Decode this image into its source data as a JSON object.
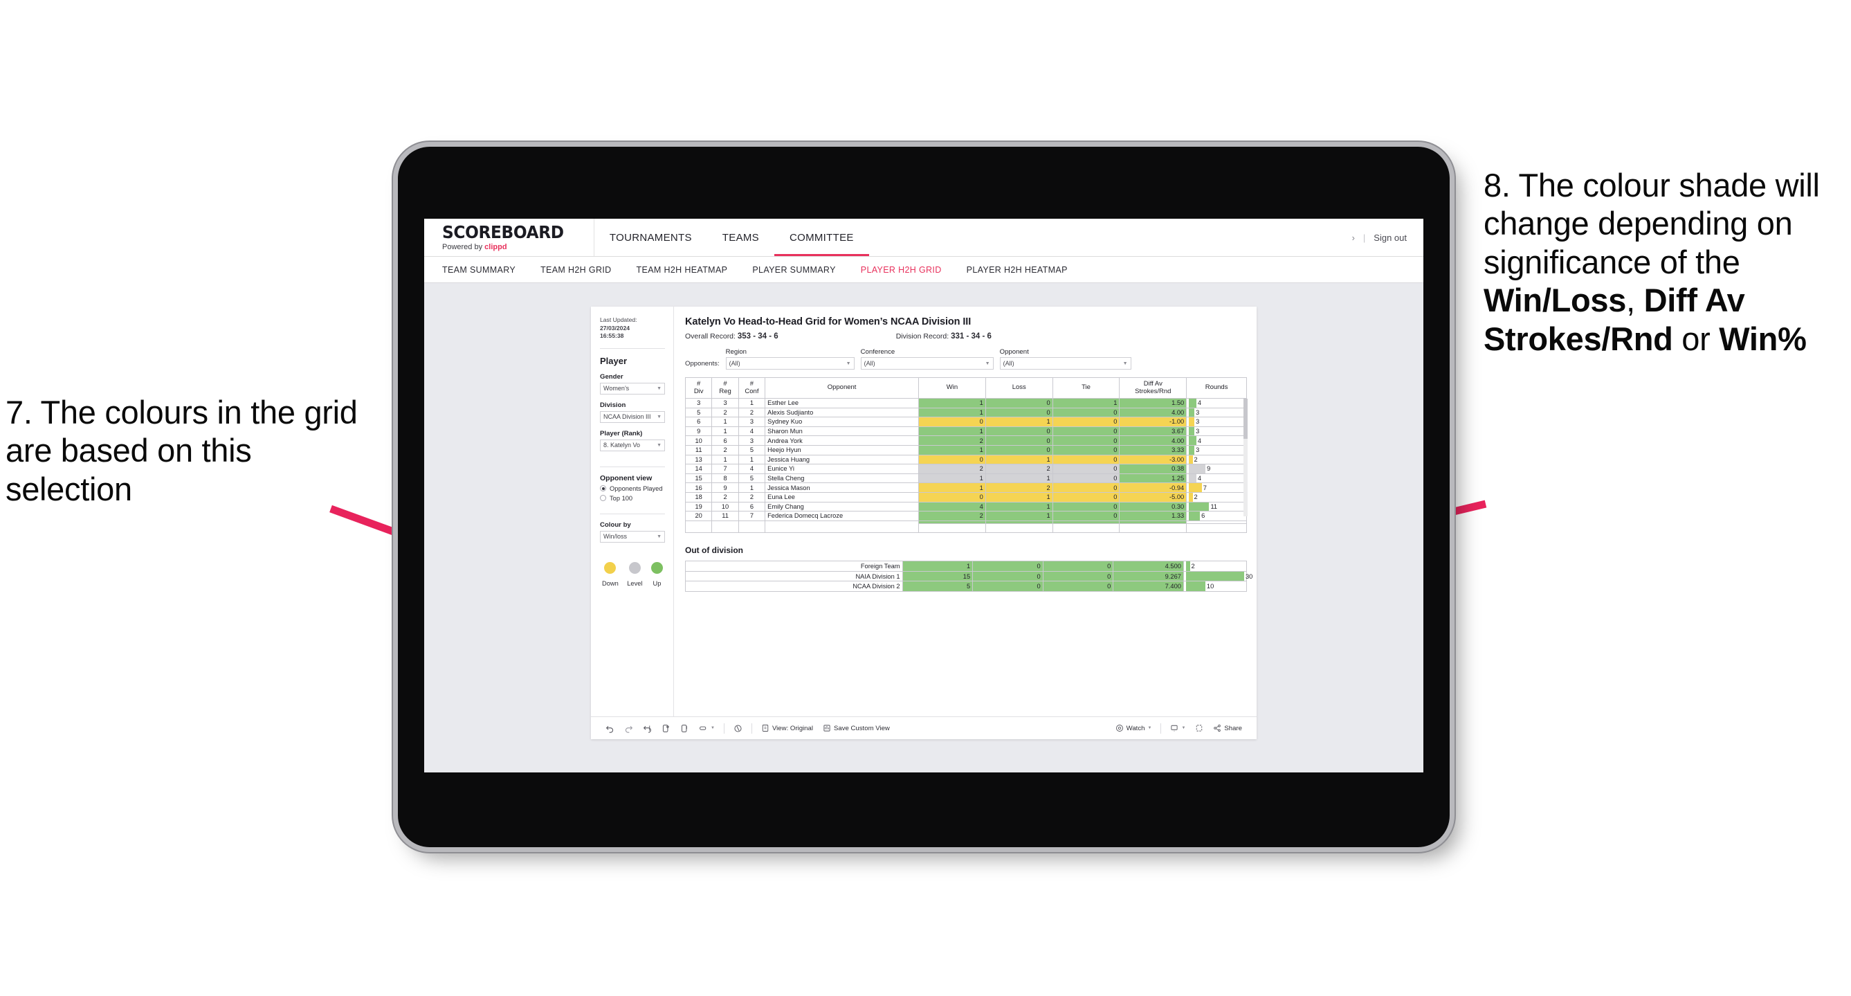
{
  "annotations": {
    "left": {
      "id": "7.",
      "text": "7. The colours in the grid are based on this selection"
    },
    "right": {
      "id": "8.",
      "prefix": "8. The colour shade will change depending on significance of the ",
      "bold1": "Win/Loss",
      "mid1": ", ",
      "bold2": "Diff Av Strokes/Rnd",
      "mid2": " or ",
      "bold3": "Win%"
    },
    "arrow_color": "#e8235c"
  },
  "app": {
    "logo": {
      "main": "SCOREBOARD",
      "sub_prefix": "Powered by ",
      "brand": "clippd"
    },
    "nav": [
      {
        "label": "TOURNAMENTS",
        "active": false
      },
      {
        "label": "TEAMS",
        "active": false
      },
      {
        "label": "COMMITTEE",
        "active": true
      }
    ],
    "header_right": {
      "chevron": "›",
      "separator": "|",
      "sign_out": "Sign out"
    },
    "subnav": [
      {
        "label": "TEAM SUMMARY",
        "active": false
      },
      {
        "label": "TEAM H2H GRID",
        "active": false
      },
      {
        "label": "TEAM H2H HEATMAP",
        "active": false
      },
      {
        "label": "PLAYER SUMMARY",
        "active": false
      },
      {
        "label": "PLAYER H2H GRID",
        "active": true
      },
      {
        "label": "PLAYER H2H HEATMAP",
        "active": false
      }
    ]
  },
  "sidebar": {
    "last_updated_label": "Last Updated: ",
    "last_updated_date": "27/03/2024",
    "last_updated_time": "16:55:38",
    "player_section_title": "Player",
    "gender_label": "Gender",
    "gender_value": "Women’s",
    "division_label": "Division",
    "division_value": "NCAA Division III",
    "player_rank_label": "Player (Rank)",
    "player_rank_value": "8. Katelyn Vo",
    "opponent_view_title": "Opponent view",
    "opponent_view_options": [
      {
        "label": "Opponents Played",
        "selected": true
      },
      {
        "label": "Top 100",
        "selected": false
      }
    ],
    "colour_by_label": "Colour by",
    "colour_by_value": "Win/loss",
    "legend": [
      {
        "label": "Down",
        "color": "#f2d04b"
      },
      {
        "label": "Level",
        "color": "#c7c7cc"
      },
      {
        "label": "Up",
        "color": "#7dc061"
      }
    ]
  },
  "main": {
    "title": "Katelyn Vo Head-to-Head Grid for Women’s NCAA Division III",
    "overall_record_label": "Overall Record: ",
    "overall_record_value": "353 -  34 - 6",
    "division_record_label": "Division Record: ",
    "division_record_value": "331 -  34 - 6",
    "opponents_label": "Opponents:",
    "filters": [
      {
        "name": "Region",
        "value": "(All)"
      },
      {
        "name": "Conference",
        "value": "(All)"
      },
      {
        "name": "Opponent",
        "value": "(All)"
      }
    ],
    "out_of_division_title": "Out of division"
  },
  "chart_data": {
    "type": "table",
    "title": "Katelyn Vo Head-to-Head Grid for Women’s NCAA Division III",
    "columns": [
      "# Div",
      "# Reg",
      "# Conf",
      "Opponent",
      "Win",
      "Loss",
      "Tie",
      "Diff Av Strokes/Rnd",
      "Rounds"
    ],
    "column_lines": [
      [
        "#",
        "Div"
      ],
      [
        "#",
        "Reg"
      ],
      [
        "#",
        "Conf"
      ],
      [
        "Opponent",
        ""
      ],
      [
        "Win",
        ""
      ],
      [
        "Loss",
        ""
      ],
      [
        "Tie",
        ""
      ],
      [
        "Diff Av",
        "Strokes/Rnd"
      ],
      [
        "Rounds",
        ""
      ]
    ],
    "colors": {
      "up": "#8dc97e",
      "down": "#f5d453",
      "level": "#d3d3d6",
      "none": "#ffffff"
    },
    "rounds_max": 30,
    "rows": [
      {
        "div": "3",
        "reg": "3",
        "conf": "1",
        "opponent": "Esther Lee",
        "win": "1",
        "loss": "0",
        "tie": "1",
        "diff": "1.50",
        "rounds": "4",
        "state": "up",
        "diff_state": "up"
      },
      {
        "div": "5",
        "reg": "2",
        "conf": "2",
        "opponent": "Alexis Sudjianto",
        "win": "1",
        "loss": "0",
        "tie": "0",
        "diff": "4.00",
        "rounds": "3",
        "state": "up",
        "diff_state": "up"
      },
      {
        "div": "6",
        "reg": "1",
        "conf": "3",
        "opponent": "Sydney Kuo",
        "win": "0",
        "loss": "1",
        "tie": "0",
        "diff": "-1.00",
        "rounds": "3",
        "state": "down",
        "diff_state": "down"
      },
      {
        "div": "9",
        "reg": "1",
        "conf": "4",
        "opponent": "Sharon Mun",
        "win": "1",
        "loss": "0",
        "tie": "0",
        "diff": "3.67",
        "rounds": "3",
        "state": "up",
        "diff_state": "up"
      },
      {
        "div": "10",
        "reg": "6",
        "conf": "3",
        "opponent": "Andrea York",
        "win": "2",
        "loss": "0",
        "tie": "0",
        "diff": "4.00",
        "rounds": "4",
        "state": "up",
        "diff_state": "up"
      },
      {
        "div": "11",
        "reg": "2",
        "conf": "5",
        "opponent": "Heejo Hyun",
        "win": "1",
        "loss": "0",
        "tie": "0",
        "diff": "3.33",
        "rounds": "3",
        "state": "up",
        "diff_state": "up"
      },
      {
        "div": "13",
        "reg": "1",
        "conf": "1",
        "opponent": "Jessica Huang",
        "win": "0",
        "loss": "1",
        "tie": "0",
        "diff": "-3.00",
        "rounds": "2",
        "state": "down",
        "diff_state": "down"
      },
      {
        "div": "14",
        "reg": "7",
        "conf": "4",
        "opponent": "Eunice Yi",
        "win": "2",
        "loss": "2",
        "tie": "0",
        "diff": "0.38",
        "rounds": "9",
        "state": "level",
        "diff_state": "up"
      },
      {
        "div": "15",
        "reg": "8",
        "conf": "5",
        "opponent": "Stella Cheng",
        "win": "1",
        "loss": "1",
        "tie": "0",
        "diff": "1.25",
        "rounds": "4",
        "state": "level",
        "diff_state": "up"
      },
      {
        "div": "16",
        "reg": "9",
        "conf": "1",
        "opponent": "Jessica Mason",
        "win": "1",
        "loss": "2",
        "tie": "0",
        "diff": "-0.94",
        "rounds": "7",
        "state": "down",
        "diff_state": "down"
      },
      {
        "div": "18",
        "reg": "2",
        "conf": "2",
        "opponent": "Euna Lee",
        "win": "0",
        "loss": "1",
        "tie": "0",
        "diff": "-5.00",
        "rounds": "2",
        "state": "down",
        "diff_state": "down"
      },
      {
        "div": "19",
        "reg": "10",
        "conf": "6",
        "opponent": "Emily Chang",
        "win": "4",
        "loss": "1",
        "tie": "0",
        "diff": "0.30",
        "rounds": "11",
        "state": "up",
        "diff_state": "up"
      },
      {
        "div": "20",
        "reg": "11",
        "conf": "7",
        "opponent": "Federica Domecq Lacroze",
        "win": "2",
        "loss": "1",
        "tie": "0",
        "diff": "1.33",
        "rounds": "6",
        "state": "up",
        "diff_state": "up"
      }
    ],
    "out_of_division_rows": [
      {
        "name": "Foreign Team",
        "win": "1",
        "loss": "0",
        "tie": "0",
        "diff": "4.500",
        "rounds": "2",
        "state": "up"
      },
      {
        "name": "NAIA Division 1",
        "win": "15",
        "loss": "0",
        "tie": "0",
        "diff": "9.267",
        "rounds": "30",
        "state": "up"
      },
      {
        "name": "NCAA Division 2",
        "win": "5",
        "loss": "0",
        "tie": "0",
        "diff": "7.400",
        "rounds": "10",
        "state": "up"
      }
    ]
  },
  "toolbar": {
    "view_label": "View: Original",
    "save_custom_view": "Save Custom View",
    "watch": "Watch",
    "share": "Share"
  }
}
